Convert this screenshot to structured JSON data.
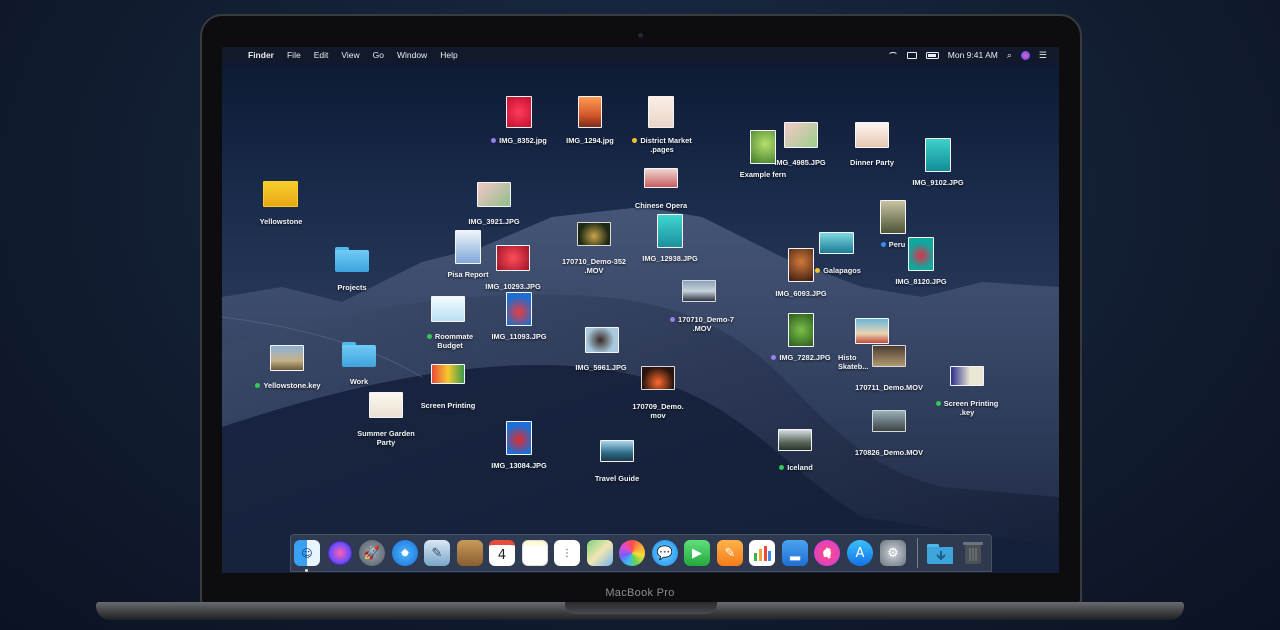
{
  "device": {
    "label": "MacBook Pro"
  },
  "menubar": {
    "app_name": "Finder",
    "menus": [
      "File",
      "Edit",
      "View",
      "Go",
      "Window",
      "Help"
    ],
    "clock": "Mon 9:41 AM"
  },
  "desktop": {
    "items": [
      {
        "label": "IMG_8352.jpg",
        "tag": "#9b7cf0"
      },
      {
        "label": "IMG_1294.jpg"
      },
      {
        "label_line1": "District Market",
        "label_line2": ".pages",
        "tag": "#f2c230"
      },
      {
        "label": "IMG_4985.JPG"
      },
      {
        "label": "Example fern"
      },
      {
        "label": "Dinner Party"
      },
      {
        "label": "IMG_9102.JPG"
      },
      {
        "label": "Chinese Opera"
      },
      {
        "label": "Yellowstone"
      },
      {
        "label": "IMG_3921.JPG"
      },
      {
        "label_line1": "170710_Demo-352",
        "label_line2": ".MOV"
      },
      {
        "label": "IMG_12938.JPG"
      },
      {
        "label": "Pisa Report"
      },
      {
        "label": "IMG_10293.JPG"
      },
      {
        "label": "Projects"
      },
      {
        "label": "Peru",
        "tag": "#3a8ef0"
      },
      {
        "label": "Galapagos",
        "tag": "#f2c230"
      },
      {
        "label": "IMG_6093.JPG"
      },
      {
        "label": "IMG_8120.JPG"
      },
      {
        "label_line1": "170710_Demo-7",
        "label_line2": ".MOV",
        "tag": "#9b7cf0"
      },
      {
        "label_line1": "Roommate",
        "label_line2": "Budget",
        "tag": "#34c759"
      },
      {
        "label": "IMG_11093.JPG"
      },
      {
        "label": "IMG_5961.JPG"
      },
      {
        "label": "IMG_7282.JPG",
        "tag": "#9b7cf0"
      },
      {
        "label_line1": "Histo",
        "label_line2": "Skateb..."
      },
      {
        "label": "170711_Demo.MOV"
      },
      {
        "label": "Yellowstone.key",
        "tag": "#34c759"
      },
      {
        "label": "Work"
      },
      {
        "label": "Screen Printing"
      },
      {
        "label_line1": "170709_Demo.",
        "label_line2": "mov"
      },
      {
        "label_line1": "Screen Printing",
        "label_line2": ".key",
        "tag": "#34c759"
      },
      {
        "label_line1": "Summer Garden",
        "label_line2": "Party"
      },
      {
        "label": "IMG_13084.JPG"
      },
      {
        "label": "Travel Guide"
      },
      {
        "label": "Iceland",
        "tag": "#34c759"
      },
      {
        "label": "170826_Demo.MOV"
      }
    ]
  },
  "dock": {
    "apps": [
      "Finder",
      "Siri",
      "Launchpad",
      "Safari",
      "Preview",
      "Notes-Book",
      "Calendar",
      "Notes",
      "Reminders",
      "Maps",
      "Photos",
      "Messages",
      "FaceTime",
      "Pages",
      "Numbers",
      "Keynote",
      "iTunes",
      "App Store",
      "System Preferences"
    ],
    "calendar_day": "4",
    "trailing": [
      "Downloads",
      "Trash"
    ]
  }
}
